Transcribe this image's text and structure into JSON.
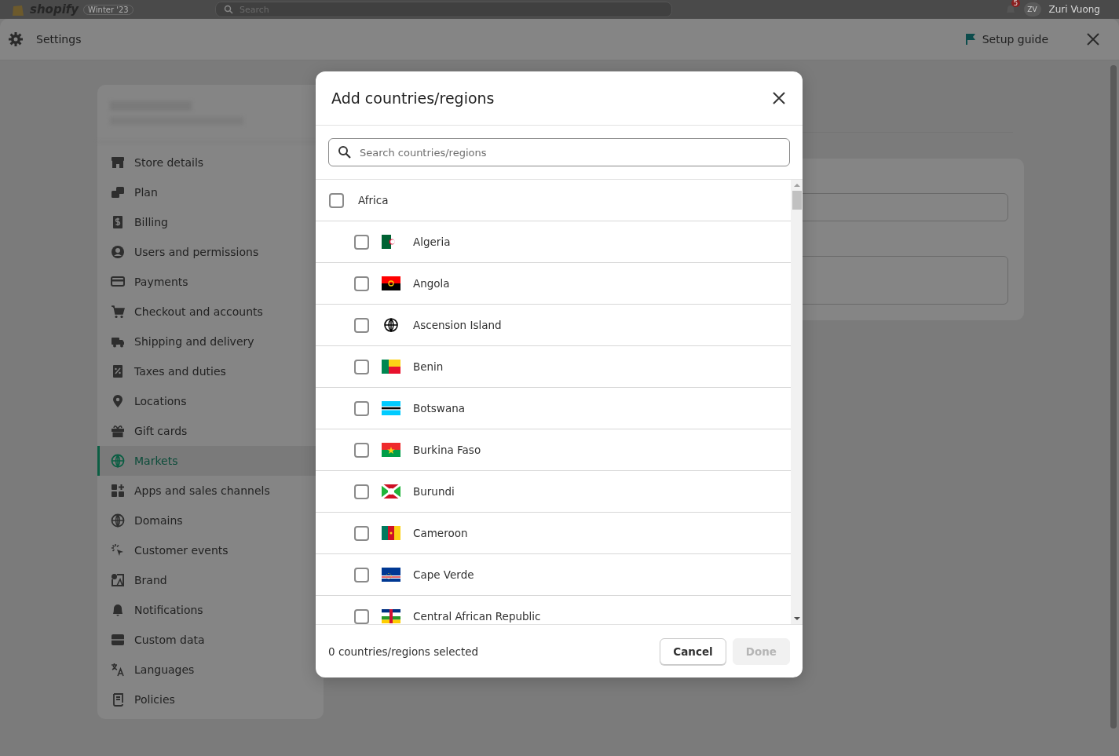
{
  "top_bar": {
    "logo": "shopify",
    "edition": "Winter '23",
    "search": {
      "placeholder": "Search"
    },
    "notifications": {
      "count": "5"
    },
    "user": {
      "initials": "ZV",
      "name": "Zuri Vuong"
    }
  },
  "header": {
    "title": "Settings",
    "setup_guide": "Setup guide"
  },
  "sidebar": {
    "items": [
      {
        "label": "Store details",
        "selected": false
      },
      {
        "label": "Plan",
        "selected": false
      },
      {
        "label": "Billing",
        "selected": false
      },
      {
        "label": "Users and permissions",
        "selected": false
      },
      {
        "label": "Payments",
        "selected": false
      },
      {
        "label": "Checkout and accounts",
        "selected": false
      },
      {
        "label": "Shipping and delivery",
        "selected": false
      },
      {
        "label": "Taxes and duties",
        "selected": false
      },
      {
        "label": "Locations",
        "selected": false
      },
      {
        "label": "Gift cards",
        "selected": false
      },
      {
        "label": "Markets",
        "selected": true
      },
      {
        "label": "Apps and sales channels",
        "selected": false
      },
      {
        "label": "Domains",
        "selected": false
      },
      {
        "label": "Customer events",
        "selected": false
      },
      {
        "label": "Brand",
        "selected": false
      },
      {
        "label": "Notifications",
        "selected": false
      },
      {
        "label": "Custom data",
        "selected": false
      },
      {
        "label": "Languages",
        "selected": false
      },
      {
        "label": "Policies",
        "selected": false
      }
    ]
  },
  "modal": {
    "title": "Add countries/regions",
    "search": {
      "placeholder": "Search countries/regions"
    },
    "group": {
      "label": "Africa",
      "checked": false,
      "children": [
        {
          "label": "Algeria",
          "checked": false
        },
        {
          "label": "Angola",
          "checked": false
        },
        {
          "label": "Ascension Island",
          "checked": false
        },
        {
          "label": "Benin",
          "checked": false
        },
        {
          "label": "Botswana",
          "checked": false
        },
        {
          "label": "Burkina Faso",
          "checked": false
        },
        {
          "label": "Burundi",
          "checked": false
        },
        {
          "label": "Cameroon",
          "checked": false
        },
        {
          "label": "Cape Verde",
          "checked": false
        },
        {
          "label": "Central African Republic",
          "checked": false
        }
      ]
    },
    "footer": {
      "summary": "0 countries/regions selected",
      "buttons": [
        {
          "label": "Cancel",
          "disabled": false
        },
        {
          "label": "Done",
          "disabled": true
        }
      ]
    }
  }
}
